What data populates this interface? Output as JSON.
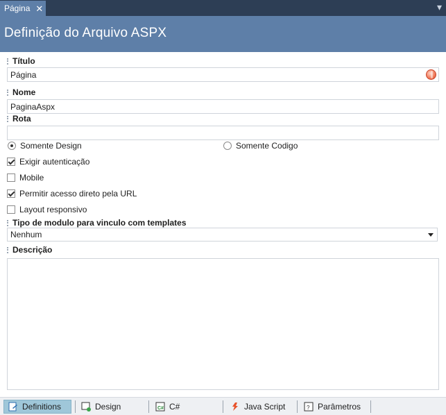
{
  "tab": {
    "title": "Página",
    "close_glyph": "✕"
  },
  "header": {
    "title": "Definição do Arquivo ASPX"
  },
  "fields": {
    "titulo": {
      "label": "Título",
      "value": "Página"
    },
    "nome": {
      "label": "Nome",
      "value": "PaginaAspx"
    },
    "rota": {
      "label": "Rota",
      "value": ""
    }
  },
  "mode": {
    "options": [
      "Somente Design",
      "Somente Codigo"
    ],
    "selected": "Somente Design"
  },
  "checkboxes": [
    {
      "label": "Exigir autenticação",
      "checked": true
    },
    {
      "label": "Mobile",
      "checked": false
    },
    {
      "label": "Permitir acesso direto pela URL",
      "checked": true
    },
    {
      "label": "Layout responsivo",
      "checked": false
    }
  ],
  "tipo_modulo": {
    "label": "Tipo de modulo para vinculo com templates",
    "selected": "Nenhum"
  },
  "descricao": {
    "label": "Descrição",
    "value": ""
  },
  "bottom_tabs": [
    {
      "label": "Definitions",
      "icon": "definitions-icon",
      "active": true
    },
    {
      "label": "Design",
      "icon": "design-icon",
      "active": false
    },
    {
      "label": "C#",
      "icon": "csharp-icon",
      "active": false
    },
    {
      "label": "Java Script",
      "icon": "javascript-icon",
      "active": false
    },
    {
      "label": "Parâmetros",
      "icon": "parameters-icon",
      "active": false
    }
  ],
  "colors": {
    "header": "#5e7fa8",
    "tabstrip": "#2d3e55",
    "active_bottom_tab": "#9fc7d9"
  }
}
